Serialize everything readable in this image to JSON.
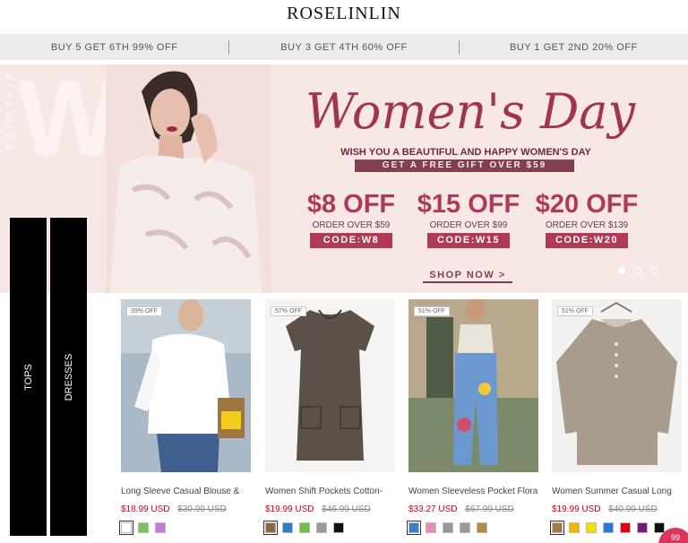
{
  "brand": {
    "logo": "ROSELINLIN"
  },
  "promos": [
    "BUY 5 GET 6TH 99% OFF",
    "BUY 3 GET 4TH 60% OFF",
    "BUY 1 GET 2ND 20% OFF"
  ],
  "hero": {
    "title": "Women's Day",
    "subtitle": "WISH YOU A BEAUTIFUL AND HAPPY WOMEN'S DAY",
    "gift": "GET A FREE GIFT OVER $59",
    "coupons": [
      {
        "amount": "$8 OFF",
        "condition": "ORDER OVER $59",
        "code": "CODE:W8"
      },
      {
        "amount": "$15 OFF",
        "condition": "ORDER OVER $99",
        "code": "CODE:W15"
      },
      {
        "amount": "$20 OFF",
        "condition": "ORDER OVER $139",
        "code": "CODE:W20"
      }
    ],
    "cta": "SHOP NOW >",
    "slides_total": 3,
    "slide_active": 1
  },
  "categories": [
    "TOPS",
    "DRESSES"
  ],
  "products": [
    {
      "badge": "39% OFF",
      "name": "Long Sleeve Casual Blouse &",
      "price": "$18.99 USD",
      "old_price": "$30.99 USD",
      "swatches": [
        "#ffffff",
        "#7dc35a",
        "#c77ad8"
      ]
    },
    {
      "badge": "57% OFF",
      "name": "Women Shift Pockets Cotton-",
      "price": "$19.99 USD",
      "old_price": "$46.99 USD",
      "swatches": [
        "#8a6a3c",
        "#2a7fc9",
        "#6fbe44",
        "#999999",
        "#111111"
      ]
    },
    {
      "badge": "51% OFF",
      "name": "Women Sleeveless Pocket Floral-",
      "price": "$33.27 USD",
      "old_price": "$67.99 USD",
      "swatches": [
        "#3a7fc8",
        "#e58bb5",
        "#999999",
        "#9a9a9a",
        "#b38a4a"
      ]
    },
    {
      "badge": "51% OFF",
      "name": "Women Summer Casual Long",
      "price": "$19.99 USD",
      "old_price": "$40.99 USD",
      "swatches": [
        "#a07c4c",
        "#f5b400",
        "#f1e000",
        "#2e73d3",
        "#e00012",
        "#7a1580",
        "#111111"
      ]
    }
  ],
  "chat": {
    "count": "99"
  }
}
